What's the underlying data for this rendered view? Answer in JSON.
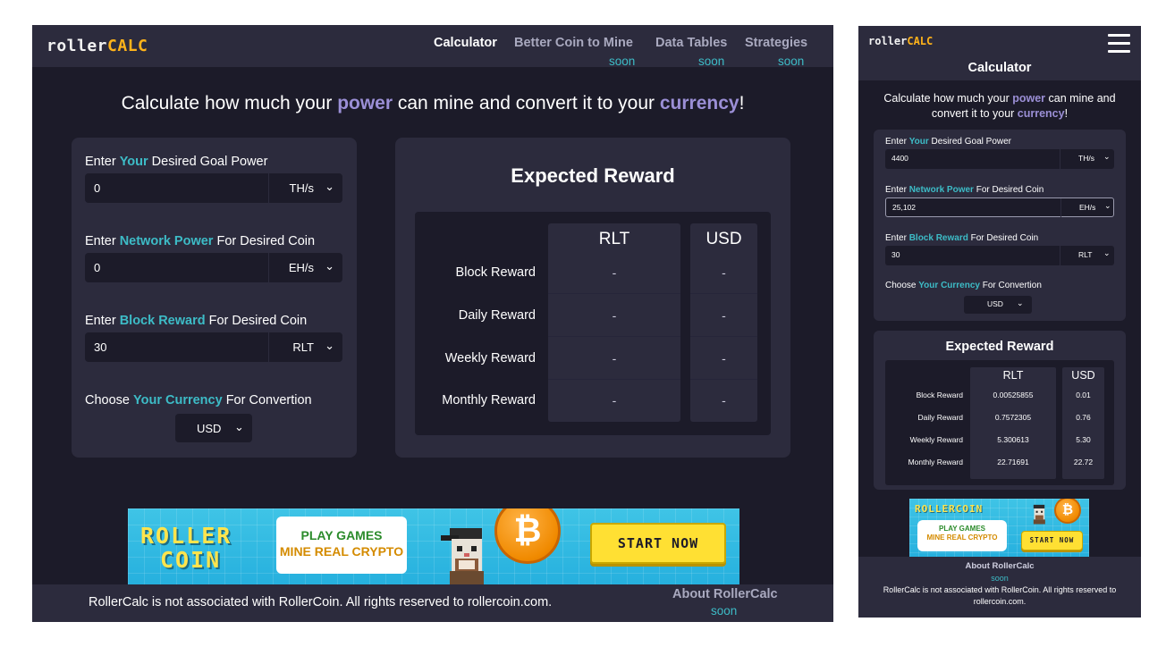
{
  "desktop": {
    "logo": {
      "part1": "roller",
      "part2": "CALC"
    },
    "nav": [
      {
        "label": "Calculator",
        "soon": ""
      },
      {
        "label": "Better Coin to Mine",
        "soon": "soon"
      },
      {
        "label": "Data Tables",
        "soon": "soon"
      },
      {
        "label": "Strategies",
        "soon": "soon"
      }
    ],
    "headline": {
      "pre": "Calculate how much your ",
      "power": "power",
      "mid": " can mine and convert it to your ",
      "currency": "currency",
      "post": "!"
    },
    "form": {
      "power_label": {
        "pre": "Enter ",
        "hl": "Your",
        "post": " Desired Goal Power"
      },
      "power_value": "0",
      "power_unit": "TH/s",
      "network_label": {
        "pre": "Enter ",
        "hl": "Network Power",
        "post": " For Desired Coin"
      },
      "network_value": "0",
      "network_unit": "EH/s",
      "block_label": {
        "pre": "Enter ",
        "hl": "Block Reward",
        "post": " For Desired Coin"
      },
      "block_value": "30",
      "block_unit": "RLT",
      "currency_label": {
        "pre": "Choose ",
        "hl": "Your Currency",
        "post": " For Convertion"
      },
      "currency_value": "USD"
    },
    "reward": {
      "title": "Expected Reward",
      "col1": "RLT",
      "col2": "USD",
      "rows": [
        {
          "label": "Block Reward",
          "rlt": "-",
          "usd": "-"
        },
        {
          "label": "Daily Reward",
          "rlt": "-",
          "usd": "-"
        },
        {
          "label": "Weekly Reward",
          "rlt": "-",
          "usd": "-"
        },
        {
          "label": "Monthly Reward",
          "rlt": "-",
          "usd": "-"
        }
      ]
    },
    "ad": {
      "logo_line1": "ROLLER",
      "logo_line2": "COIN",
      "play": "PLAY GAMES",
      "mine": "MINE REAL CRYPTO",
      "coin": "₿",
      "button": "START NOW"
    },
    "footer": {
      "note": "RollerCalc is not associated with RollerCoin. All rights reserved to rollercoin.com.",
      "about": "About RollerCalc",
      "about_soon": "soon"
    }
  },
  "mobile": {
    "logo": {
      "part1": "roller",
      "part2": "CALC"
    },
    "current_page": "Calculator",
    "headline": {
      "pre": "Calculate how much your ",
      "power": "power",
      "mid": " can mine and convert it to your ",
      "currency": "currency",
      "post": "!"
    },
    "form": {
      "power_label": {
        "pre": "Enter ",
        "hl": "Your",
        "post": " Desired Goal Power"
      },
      "power_value": "4400",
      "power_unit": "TH/s",
      "network_label": {
        "pre": "Enter ",
        "hl": "Network Power",
        "post": " For Desired Coin"
      },
      "network_value": "25,102",
      "network_unit": "EH/s",
      "block_label": {
        "pre": "Enter ",
        "hl": "Block Reward",
        "post": " For Desired Coin"
      },
      "block_value": "30",
      "block_unit": "RLT",
      "currency_label": {
        "pre": "Choose ",
        "hl": "Your Currency",
        "post": " For Convertion"
      },
      "currency_value": "USD"
    },
    "reward": {
      "title": "Expected Reward",
      "col1": "RLT",
      "col2": "USD",
      "rows": [
        {
          "label": "Block Reward",
          "rlt": "0.00525855",
          "usd": "0.01"
        },
        {
          "label": "Daily Reward",
          "rlt": "0.7572305",
          "usd": "0.76"
        },
        {
          "label": "Weekly Reward",
          "rlt": "5.300613",
          "usd": "5.30"
        },
        {
          "label": "Monthly Reward",
          "rlt": "22.71691",
          "usd": "22.72"
        }
      ]
    },
    "ad": {
      "logo": "ROLLERCOIN",
      "play": "PLAY GAMES",
      "mine": "MINE REAL CRYPTO",
      "coin": "₿",
      "button": "START NOW"
    },
    "footer": {
      "about": "About RollerCalc",
      "about_soon": "soon",
      "note": "RollerCalc is not associated with RollerCoin. All rights reserved to rollercoin.com."
    }
  },
  "colors": {
    "background": "#1c1b29",
    "panel": "#2c2b3d",
    "teal": "#3dbcc7",
    "purple": "#9b8fd6",
    "orange": "#ffb31a"
  },
  "icons": {
    "select_chevron": "chevron-down-icon",
    "menu": "hamburger-menu-icon",
    "bitcoin": "bitcoin-coin-icon"
  }
}
